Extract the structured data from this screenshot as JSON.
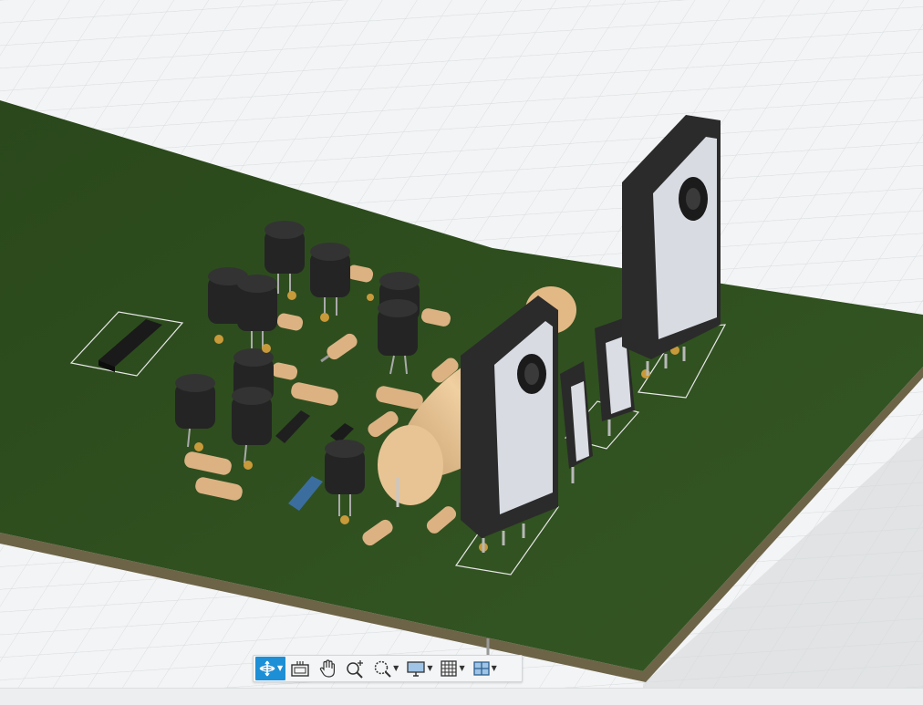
{
  "viewport": {
    "name": "3d-pcb-viewport",
    "board_color": "#2f4d1f",
    "background_color": "#f2f3f4",
    "grid_color": "#dadde0"
  },
  "toolbar": {
    "accent": "#1d8fd6",
    "buttons": [
      {
        "id": "orbit",
        "icon": "orbit-icon",
        "has_menu": true,
        "active": true
      },
      {
        "id": "look-at",
        "icon": "look-at-icon",
        "has_menu": false,
        "active": false
      },
      {
        "id": "pan",
        "icon": "pan-hand-icon",
        "has_menu": false,
        "active": false
      },
      {
        "id": "zoom",
        "icon": "zoom-icon",
        "has_menu": false,
        "active": false
      },
      {
        "id": "fit",
        "icon": "zoom-window-icon",
        "has_menu": true,
        "active": false
      },
      {
        "id": "display",
        "icon": "display-settings-icon",
        "has_menu": true,
        "active": false
      },
      {
        "id": "grid",
        "icon": "grid-icon",
        "has_menu": true,
        "active": false
      },
      {
        "id": "viewports",
        "icon": "viewports-icon",
        "has_menu": true,
        "active": false
      }
    ]
  }
}
